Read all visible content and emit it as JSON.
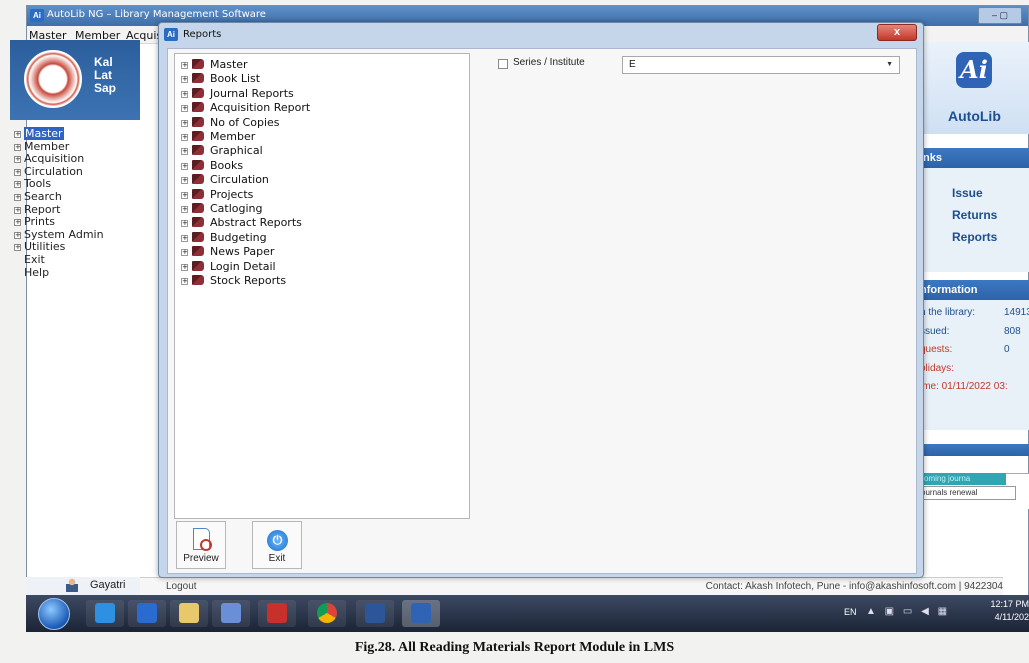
{
  "app": {
    "title": "AutoLib NG – Library Management Software",
    "logo_text": "Ai",
    "window_controls": "– ▢",
    "menu": [
      "Master",
      "Member",
      "Acquis"
    ]
  },
  "banner": {
    "lines": [
      "Kal",
      "Lat",
      "Sap"
    ]
  },
  "sidebar": {
    "items": [
      {
        "label": "Master",
        "expand": "+",
        "selected": true
      },
      {
        "label": "Member",
        "expand": "+"
      },
      {
        "label": "Acquisition",
        "expand": "+"
      },
      {
        "label": "Circulation",
        "expand": "+"
      },
      {
        "label": "Tools",
        "expand": "+"
      },
      {
        "label": "Search",
        "expand": "+"
      },
      {
        "label": "Report",
        "expand": "+"
      },
      {
        "label": "Prints",
        "expand": "+"
      },
      {
        "label": "System Admin",
        "expand": "+"
      },
      {
        "label": "Utilities",
        "expand": "+"
      },
      {
        "label": "Exit",
        "expand": ""
      },
      {
        "label": "Help",
        "expand": ""
      }
    ]
  },
  "user": {
    "name": "Gayatri"
  },
  "statusbar": {
    "logout": "Logout",
    "contact": "Contact: Akash Infotech, Pune - info@akashinfosoft.com | 9422304"
  },
  "right_panel": {
    "logo_mark": "Ai",
    "logo_name": "AutoLib",
    "links_header": "inks",
    "quick_links": [
      "Issue",
      "Returns",
      "Reports"
    ],
    "info_header": "nformation",
    "info": [
      {
        "label": "n the library:",
        "value": "14913",
        "red": false
      },
      {
        "label": "ssued:",
        "value": "808",
        "red": false
      },
      {
        "label": "quests:",
        "value": "0",
        "red": true
      },
      {
        "label": "olidays:",
        "value": "",
        "red": true
      },
      {
        "label": "ime: 01/11/2022 03:",
        "value": "",
        "red": true
      }
    ],
    "journal_tab_1": "coming journa",
    "journal_tab_2": "ournals renewal"
  },
  "dialog": {
    "title": "Reports",
    "close": "x",
    "tree_items": [
      "Master",
      "Book List",
      "Journal Reports",
      "Acquisition Report",
      "No of Copies",
      "Member",
      "Graphical",
      "Books",
      "Circulation",
      "Projects",
      "Catloging",
      "Abstract Reports",
      "Budgeting",
      "News Paper",
      "Login Detail",
      "Stock Reports"
    ],
    "series_label": "Series / Institute",
    "series_value": "E",
    "preview_label": "Preview",
    "exit_label": "Exit"
  },
  "taskbar": {
    "lang": "EN",
    "time": "12:17 PM",
    "date": "4/11/202"
  },
  "caption": "Fig.28. All Reading Materials Report Module in LMS",
  "colors": {
    "accent": "#2f64c4",
    "header_blue": "#2d63a8",
    "link_blue": "#1d4f8f",
    "alert_red": "#c0392b"
  }
}
